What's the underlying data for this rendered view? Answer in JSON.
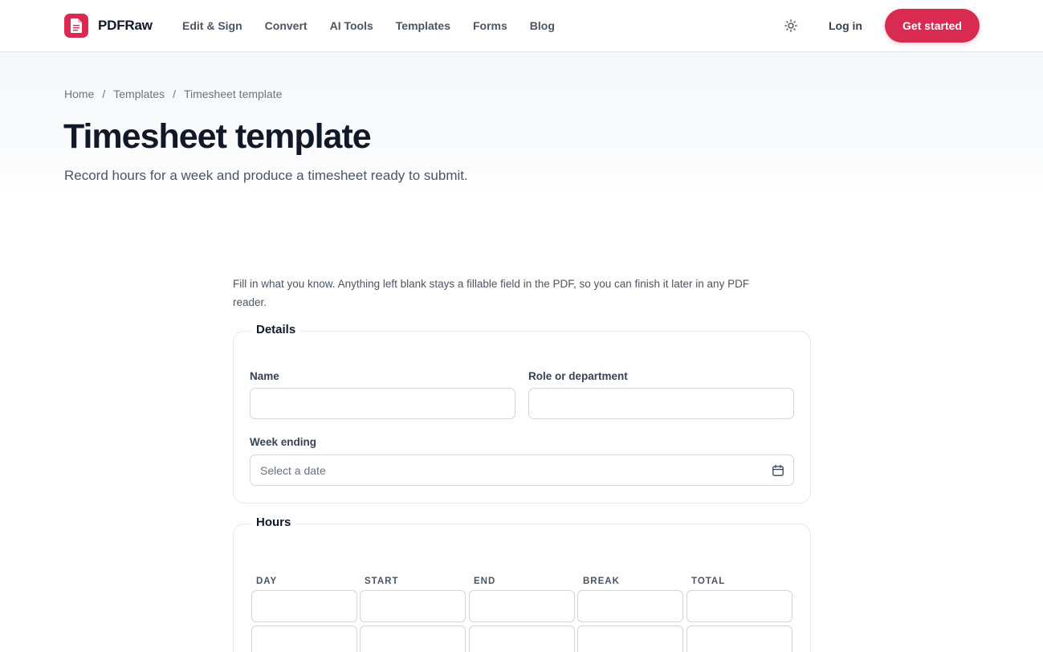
{
  "brand": {
    "name": "PDFRaw"
  },
  "nav": {
    "items": [
      {
        "label": "Edit & Sign"
      },
      {
        "label": "Convert"
      },
      {
        "label": "AI Tools"
      },
      {
        "label": "Templates"
      },
      {
        "label": "Forms"
      },
      {
        "label": "Blog"
      }
    ],
    "login_label": "Log in",
    "cta_label": "Get started",
    "theme_icon": "sun-icon"
  },
  "breadcrumb": {
    "items": [
      {
        "label": "Home"
      },
      {
        "label": "Templates"
      },
      {
        "label": "Timesheet template"
      }
    ],
    "separator": "/"
  },
  "page": {
    "title": "Timesheet template",
    "subtitle": "Record hours for a week and produce a timesheet ready to submit."
  },
  "intro": "Fill in what you know. Anything left blank stays a fillable field in the PDF, so you can finish it later in any PDF reader.",
  "details": {
    "legend": "Details",
    "name_label": "Name",
    "name_value": "",
    "role_label": "Role or department",
    "role_value": "",
    "week_label": "Week ending",
    "week_placeholder": "Select a date",
    "week_value": ""
  },
  "hours": {
    "legend": "Hours",
    "columns": [
      {
        "label": "DAY"
      },
      {
        "label": "START"
      },
      {
        "label": "END"
      },
      {
        "label": "BREAK"
      },
      {
        "label": "TOTAL"
      }
    ]
  },
  "colors": {
    "brand": "#d92b52",
    "text": "#111827",
    "muted": "#6b7280",
    "border": "#d1d5db"
  }
}
